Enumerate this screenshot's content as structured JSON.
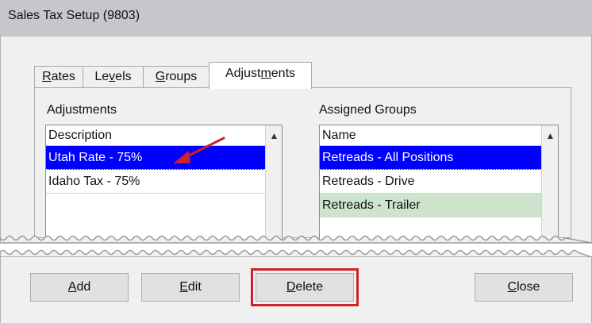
{
  "window": {
    "title": "Sales Tax Setup (9803)"
  },
  "tabs": [
    {
      "label_pre": "",
      "accel": "R",
      "label_post": "ates"
    },
    {
      "label_pre": "Le",
      "accel": "v",
      "label_post": "els"
    },
    {
      "label_pre": "",
      "accel": "G",
      "label_post": "roups"
    },
    {
      "label_pre": "Adjust",
      "accel": "m",
      "label_post": "ents"
    }
  ],
  "active_tab": "Adjustments",
  "adjustments": {
    "group_label": "Adjustments",
    "column": "Description",
    "rows": [
      "Utah Rate - 75%",
      "Idaho Tax - 75%"
    ],
    "selected": "Utah Rate - 75%"
  },
  "assigned_groups": {
    "group_label": "Assigned Groups",
    "column": "Name",
    "rows": [
      "Retreads - All Positions",
      "Retreads - Drive",
      "Retreads - Trailer"
    ],
    "selected": "Retreads - All Positions",
    "highlighted": "Retreads - Trailer"
  },
  "buttons": {
    "add": {
      "accel": "A",
      "rest": "dd"
    },
    "edit": {
      "accel": "E",
      "rest": "dit"
    },
    "delete": {
      "accel": "D",
      "rest": "elete"
    },
    "close": {
      "accel": "C",
      "rest": "lose"
    }
  },
  "colors": {
    "selection": "#0000ff",
    "highlight_row": "#cfe4cd",
    "annotation_red": "#cc2229",
    "titlebar": "#c6c7ca"
  },
  "icons": {
    "scroll_up": "▲"
  }
}
